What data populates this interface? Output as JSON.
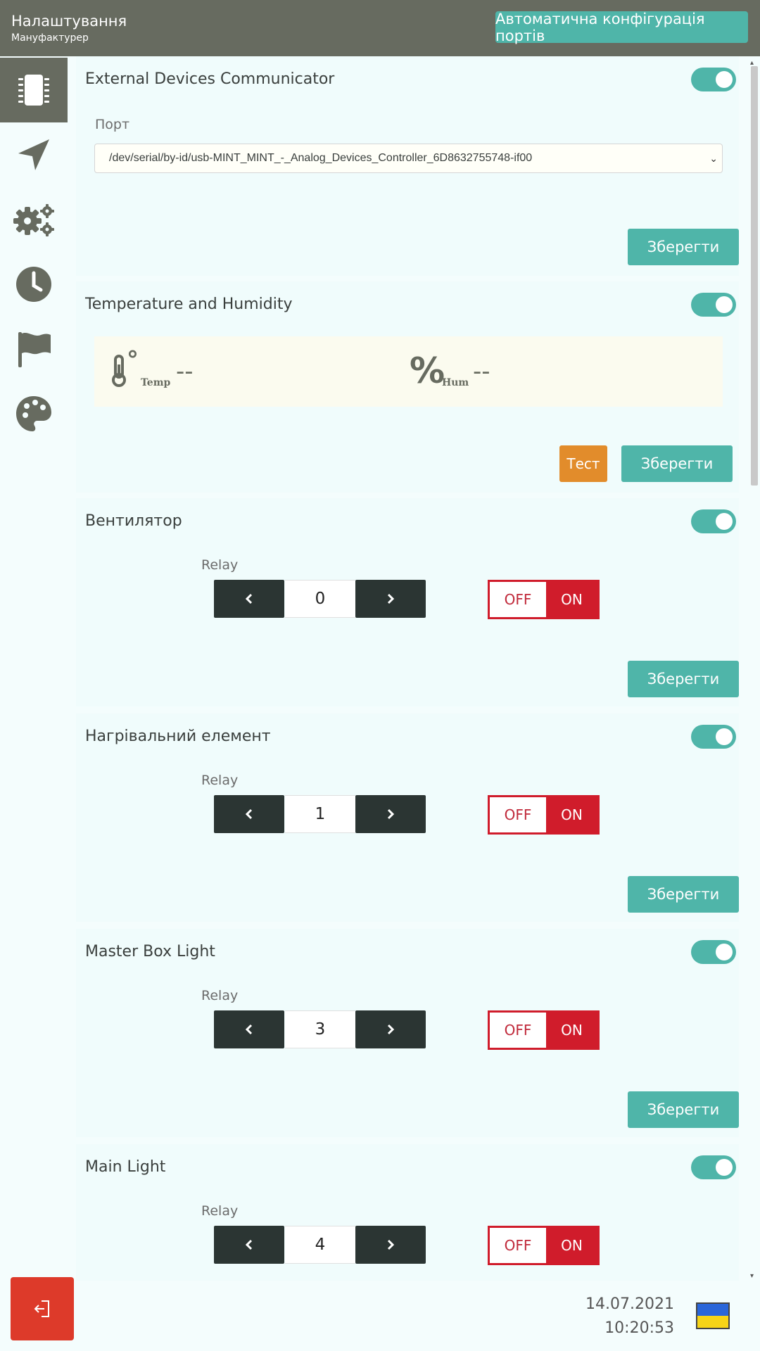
{
  "header": {
    "title": "Налаштування",
    "subtitle": "Мануфактурер",
    "auto_config_label": "Автоматична конфігурація портів"
  },
  "sidebar": {
    "items": [
      {
        "icon": "chip-icon",
        "active": true
      },
      {
        "icon": "navigation-arrow-icon",
        "active": false
      },
      {
        "icon": "gears-icon",
        "active": false
      },
      {
        "icon": "clock-icon",
        "active": false
      },
      {
        "icon": "flag-icon",
        "active": false
      },
      {
        "icon": "palette-icon",
        "active": false
      }
    ]
  },
  "cards": {
    "external": {
      "title": "External Devices Communicator",
      "enabled": true,
      "port_label": "Порт",
      "port_value": "/dev/serial/by-id/usb-MINT_MINT_-_Analog_Devices_Controller_6D8632755748-if00",
      "save_label": "Зберегти"
    },
    "temp_hum": {
      "title": "Temperature and Humidity",
      "enabled": true,
      "temp_symbol": "°",
      "temp_label": "Temp",
      "temp_value": "--",
      "hum_symbol": "%",
      "hum_label": "Hum",
      "hum_value": "--",
      "test_label": "Тест",
      "save_label": "Зберегти"
    },
    "fan": {
      "title": "Вентилятор",
      "enabled": true,
      "relay_label": "Relay",
      "relay_value": "0",
      "off_label": "OFF",
      "on_label": "ON",
      "state": "ON",
      "save_label": "Зберегти"
    },
    "heater": {
      "title": "Нагрівальний елемент",
      "enabled": true,
      "relay_label": "Relay",
      "relay_value": "1",
      "off_label": "OFF",
      "on_label": "ON",
      "state": "ON",
      "save_label": "Зберегти"
    },
    "master_box": {
      "title": "Master Box Light",
      "enabled": true,
      "relay_label": "Relay",
      "relay_value": "3",
      "off_label": "OFF",
      "on_label": "ON",
      "state": "ON",
      "save_label": "Зберегти"
    },
    "main_light": {
      "title": "Main Light",
      "enabled": true,
      "relay_label": "Relay",
      "relay_value": "4",
      "off_label": "OFF",
      "on_label": "ON",
      "state": "ON"
    }
  },
  "footer": {
    "date": "14.07.2021",
    "time": "10:20:53",
    "logout_icon": "logout-icon",
    "language_flag": "ukraine-flag-icon"
  },
  "colors": {
    "header_bg": "#676b60",
    "accent": "#4fb5a9",
    "test": "#e28c2b",
    "danger": "#d01c2b",
    "logout": "#dd3a2a",
    "stepper": "#2b3533",
    "flag_blue": "#2a66d9",
    "flag_yellow": "#f7d417"
  }
}
